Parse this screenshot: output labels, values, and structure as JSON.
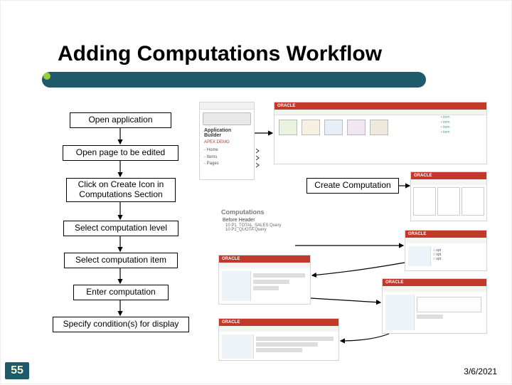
{
  "slide": {
    "title": "Adding Computations Workflow",
    "page_number": "55",
    "date": "3/6/2021"
  },
  "steps": [
    "Open application",
    "Open page to be edited",
    "Click on Create Icon in Computations Section",
    "Select computation level",
    "Select computation item",
    "Enter computation",
    "Specify condition(s) for display"
  ],
  "callouts": {
    "create_computation": "Create Computation",
    "computations_header": "Computations"
  },
  "thumbnails": {
    "oracle_label": "ORACLE"
  }
}
